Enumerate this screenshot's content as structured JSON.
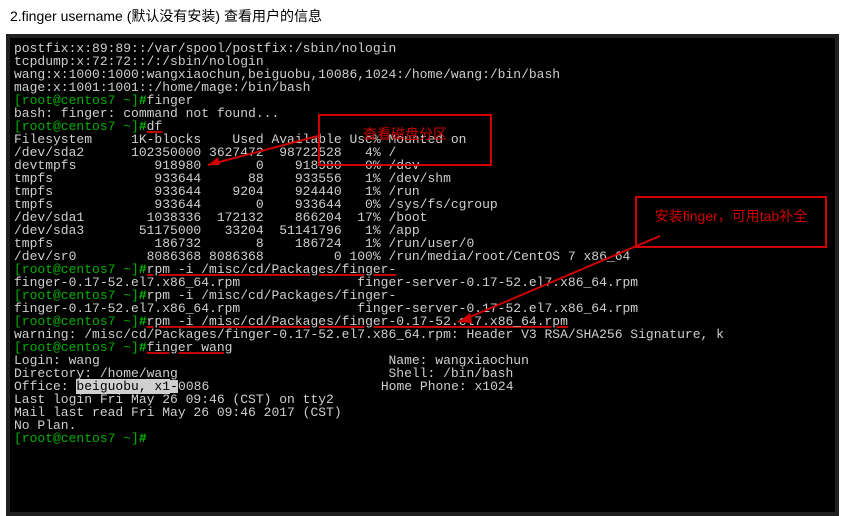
{
  "heading": "2.finger username (默认没有安装) 查看用户的信息",
  "annotation1": "查看磁盘分区",
  "annotation2": "安装finger，可用tab补全",
  "raw_lines": [
    {
      "text": "postfix:x:89:89::/var/spool/postfix:/sbin/nologin"
    },
    {
      "text": "tcpdump:x:72:72::/:/sbin/nologin"
    },
    {
      "text": "wang:x:1000:1000:wangxiaochun,beiguobu,10086,1024:/home/wang:/bin/bash"
    },
    {
      "text": "mage:x:1001:1001::/home/mage:/bin/bash"
    }
  ],
  "prompt": {
    "user": "[root@centos7 ~]",
    "hash": "#"
  },
  "cmd_finger": "finger",
  "bash_err": "bash: finger: command not found...",
  "cmd_df": "df",
  "df_header": "Filesystem     1K-blocks    Used Available Use% Mounted on",
  "df_rows": [
    {
      "fs": "/dev/sda2",
      "blk": "102350000",
      "used": "3627472",
      "avail": "98722528",
      "use": "4%",
      "mnt": "/"
    },
    {
      "fs": "devtmpfs",
      "blk": "918980",
      "used": "0",
      "avail": "918980",
      "use": "0%",
      "mnt": "/dev"
    },
    {
      "fs": "tmpfs",
      "blk": "933644",
      "used": "88",
      "avail": "933556",
      "use": "1%",
      "mnt": "/dev/shm"
    },
    {
      "fs": "tmpfs",
      "blk": "933644",
      "used": "9204",
      "avail": "924440",
      "use": "1%",
      "mnt": "/run"
    },
    {
      "fs": "tmpfs",
      "blk": "933644",
      "used": "0",
      "avail": "933644",
      "use": "0%",
      "mnt": "/sys/fs/cgroup"
    },
    {
      "fs": "/dev/sda1",
      "blk": "1038336",
      "used": "172132",
      "avail": "866204",
      "use": "17%",
      "mnt": "/boot"
    },
    {
      "fs": "/dev/sda3",
      "blk": "51175000",
      "used": "33204",
      "avail": "51141796",
      "use": "1%",
      "mnt": "/app"
    },
    {
      "fs": "tmpfs",
      "blk": "186732",
      "used": "8",
      "avail": "186724",
      "use": "1%",
      "mnt": "/run/user/0"
    },
    {
      "fs": "/dev/sr0",
      "blk": "8086368",
      "used": "8086368",
      "avail": "0",
      "use": "100%",
      "mnt": "/run/media/root/CentOS 7 x86_64"
    }
  ],
  "rpm_cmd1": "rpm -i /misc/cd/Packages/finger-",
  "rpm_out1a": "finger-0.17-52.el7.x86_64.rpm",
  "rpm_out1b": "finger-server-0.17-52.el7.x86_64.rpm",
  "rpm_cmd2": "rpm -i /misc/cd/Packages/finger-",
  "rpm_out2a": "finger-0.17-52.el7.x86_64.rpm",
  "rpm_out2b": "finger-server-0.17-52.el7.x86_64.rpm",
  "rpm_cmd3": "rpm -i /misc/cd/Packages/finger-0.17-52.el7.x86_64.rpm",
  "rpm_warn": "warning: /misc/cd/Packages/finger-0.17-52.el7.x86_64.rpm: Header V3 RSA/SHA256 Signature, k",
  "cmd_finger_wang": "finger wang",
  "info": {
    "login": "Login: wang",
    "name": "Name: wangxiaochun",
    "dir": "Directory: /home/wang",
    "shell": "Shell: /bin/bash",
    "office_lbl": "Office:",
    "office_val": "beiguobu, x1-0086",
    "home_phone": "Home Phone: x1024",
    "lastlogin": "Last login Fri May 26 09:46 (CST) on tty2",
    "mail": "Mail last read Fri May 26 09:46 2017 (CST)",
    "noplan": "No Plan."
  }
}
